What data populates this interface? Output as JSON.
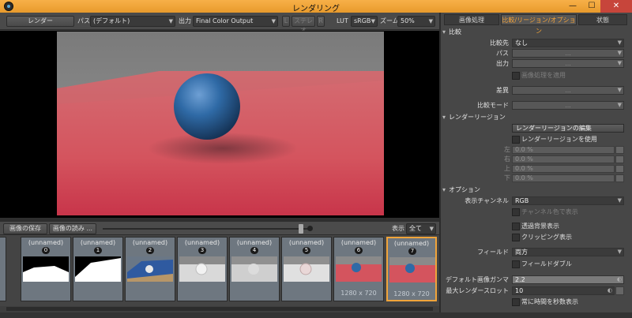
{
  "window": {
    "title": "レンダリング",
    "min": "—",
    "max": "☐",
    "close": "✕"
  },
  "toolbar": {
    "render_button": "レンダー",
    "path_label": "パス",
    "path_value": "(デフォルト)",
    "output_label": "出力",
    "output_value": "Final Color Output",
    "stereo_l": "L",
    "stereo_label": "ステレオ",
    "stereo_r": "R",
    "lut_label": "LUT",
    "lut_value": "sRGB",
    "zoom_label": "ズーム",
    "zoom_value": "50%"
  },
  "history_bar": {
    "save_button": "画像の保存",
    "load_button": "画像の読み ...",
    "display_label": "表示",
    "display_value": "全て"
  },
  "thumbnails": [
    {
      "name": "(unnamed)",
      "index": "0",
      "resolution": "",
      "kind": "mask-a"
    },
    {
      "name": "(unnamed)",
      "index": "1",
      "resolution": "",
      "kind": "mask-b"
    },
    {
      "name": "(unnamed)",
      "index": "2",
      "resolution": "",
      "kind": "scene-blue"
    },
    {
      "name": "(unnamed)",
      "index": "3",
      "resolution": "",
      "kind": "clay"
    },
    {
      "name": "(unnamed)",
      "index": "4",
      "resolution": "",
      "kind": "clay-faint"
    },
    {
      "name": "(unnamed)",
      "index": "5",
      "resolution": "",
      "kind": "clay-pink"
    },
    {
      "name": "(unnamed)",
      "index": "6",
      "resolution": "1280 x 720",
      "kind": "final"
    },
    {
      "name": "(unnamed)",
      "index": "7",
      "resolution": "1280 x 720",
      "kind": "final",
      "selected": true
    }
  ],
  "panel": {
    "tabs": [
      "画像処理",
      "比較/リージョン/オプション",
      "状態"
    ],
    "active_tab": 1,
    "compare": {
      "section": "比較",
      "compare_to_label": "比較先",
      "compare_to_value": "なし",
      "path_label": "パス",
      "output_label": "出力",
      "apply_processing": "画像処理を適用",
      "difference_label": "差異",
      "compare_mode_label": "比較モード",
      "ellipsis": "..."
    },
    "region": {
      "section": "レンダーリージョン",
      "edit_button": "レンダーリージョンの編集",
      "use_region": "レンダーリージョンを使用",
      "left_label": "左",
      "left_value": "0.0 %",
      "right_label": "右",
      "right_value": "0.0 %",
      "top_label": "上",
      "top_value": "0.0 %",
      "bottom_label": "下",
      "bottom_value": "0.0 %"
    },
    "options": {
      "section": "オプション",
      "channel_label": "表示チャンネル",
      "channel_value": "RGB",
      "show_channel_color": "チャンネル色で表示",
      "show_transparent_bg": "透過背景表示",
      "show_clipping": "クリッピング表示",
      "field_label": "フィールド",
      "field_value": "両方",
      "field_double": "フィールドダブル",
      "gamma_label": "デフォルト画像ガンマ",
      "gamma_value": "2.2",
      "max_slots_label": "最大レンダースロット",
      "max_slots_value": "10",
      "show_time_seconds": "常に時間を秒数表示"
    }
  },
  "colors": {
    "accent": "#f0a43a",
    "title_bar": "#eea03a",
    "panel": "#474747",
    "floor": "#d4545e",
    "sphere": "#2f6aa6"
  }
}
